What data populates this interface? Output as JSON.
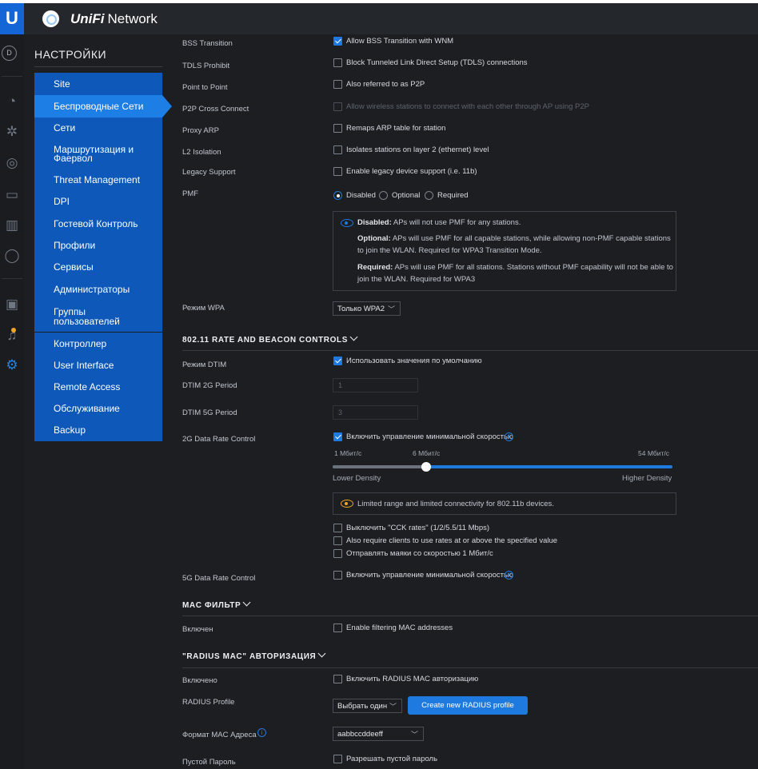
{
  "app": {
    "brand_unifi": "UniFi",
    "brand_network": "Network",
    "avatar_letter": "D",
    "logo": "U"
  },
  "settings": {
    "title": "НАСТРОЙКИ"
  },
  "nav": [
    {
      "label": "Site"
    },
    {
      "label": "Беспроводные Сети"
    },
    {
      "label": "Сети"
    },
    {
      "label": "Маршрутизация и Фаервол"
    },
    {
      "label": "Threat Management"
    },
    {
      "label": "DPI"
    },
    {
      "label": "Гостевой Контроль"
    },
    {
      "label": "Профили"
    },
    {
      "label": "Сервисы"
    },
    {
      "label": "Администраторы"
    },
    {
      "label": "Группы пользователей"
    },
    {
      "label": "Контроллер"
    },
    {
      "label": "User Interface"
    },
    {
      "label": "Remote Access"
    },
    {
      "label": "Обслуживание"
    },
    {
      "label": "Backup"
    }
  ],
  "rows": {
    "bss": {
      "label": "BSS Transition",
      "text": "Allow BSS Transition with WNM",
      "checked": true
    },
    "tdls": {
      "label": "TDLS Prohibit",
      "text": "Block Tunneled Link Direct Setup (TDLS) connections",
      "checked": false
    },
    "p2p": {
      "label": "Point to Point",
      "text": "Also referred to as P2P",
      "checked": false
    },
    "p2pcc": {
      "label": "P2P Cross Connect",
      "text": "Allow wireless stations to connect with each other through AP using P2P",
      "checked": false
    },
    "proxyarp": {
      "label": "Proxy ARP",
      "text": "Remaps ARP table for station",
      "checked": false
    },
    "l2": {
      "label": "L2 Isolation",
      "text": "Isolates stations on layer 2 (ethernet) level",
      "checked": false
    },
    "legacy": {
      "label": "Legacy Support",
      "text": "Enable legacy device support (i.e. 11b)",
      "checked": false
    }
  },
  "pmf": {
    "label": "PMF",
    "options": [
      "Disabled",
      "Optional",
      "Required"
    ],
    "selected": "Disabled",
    "info": {
      "disabled_b": "Disabled:",
      "disabled_t": " APs will not use PMF for any stations.",
      "optional_b": "Optional:",
      "optional_t1": " APs will use PMF for all capable stations, while allowing non-PMF capable stations",
      "optional_t2": "to join the WLAN. Required for WPA3 Transition Mode.",
      "required_b": "Required:",
      "required_t1": " APs will use PMF for all stations. Stations without PMF capability will not be able to",
      "required_t2": "join the WLAN. Required for WPA3"
    }
  },
  "wpa": {
    "label": "Режим WPA",
    "value": "Только WPA2"
  },
  "rate_section": {
    "title": "802.11 RATE AND BEACON CONTROLS"
  },
  "dtim": {
    "label": "Режим DTIM",
    "text": "Использовать значения по умолчанию",
    "checked": true,
    "p2_label": "DTIM 2G Period",
    "p2_value": "1",
    "p5_label": "DTIM 5G Period",
    "p5_value": "3"
  },
  "rate2g": {
    "label": "2G Data Rate Control",
    "text": "Включить управление минимальной скоростью",
    "checked": true,
    "min_label": "1 Мбит/с",
    "cur_label": "6 Мбит/с",
    "max_label": "54 Мбит/с",
    "slider_fraction": 0.28,
    "low": "Lower Density",
    "high": "Higher Density",
    "warning": "Limited range and limited connectivity for 802.11b devices.",
    "opt1": "Выключить \"CCK rates\" (1/2/5.5/11 Mbps)",
    "opt2": "Also require clients to use rates at or above the specified value",
    "opt3": "Отправлять маяки со скоростью 1 Мбит/с"
  },
  "rate5g": {
    "label": "5G Data Rate Control",
    "text": "Включить управление минимальной скоростью",
    "checked": false
  },
  "mac_section": {
    "title": "MAC ФИЛЬТР"
  },
  "mac": {
    "label": "Включен",
    "text": "Enable filtering MAC addresses",
    "checked": false
  },
  "radius_section": {
    "title": "\"RADIUS MAC\" АВТОРИЗАЦИЯ"
  },
  "radius": {
    "label": "Включено",
    "text": "Включить RADIUS MAC авторизацию",
    "checked": false,
    "profile_label": "RADIUS Profile",
    "profile_value": "Выбрать один",
    "create_button": "Create new RADIUS profile",
    "format_label": "Формат MAC Адреса",
    "format_value": "aabbccddeeff",
    "empty_label": "Пустой Пароль",
    "empty_text": "Разрешать пустой пароль"
  },
  "colors": {
    "accent": "#1f7ae0",
    "nav_bg": "#0d58b8",
    "nav_selected": "#1d7ee6",
    "warning": "#f5a623"
  }
}
